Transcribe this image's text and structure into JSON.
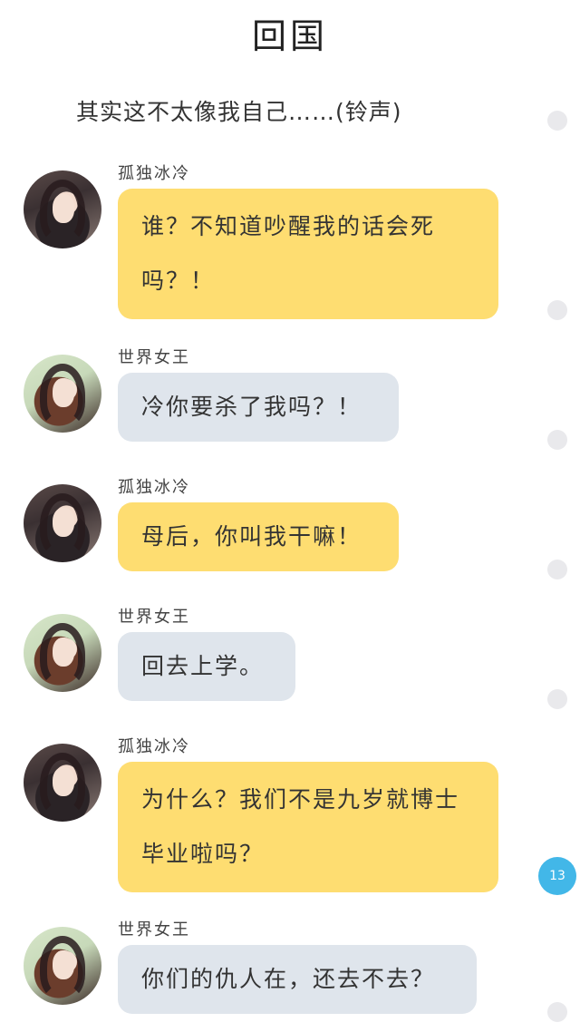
{
  "title": "回国",
  "narration": "其实这不太像我自己……(铃声)",
  "messages": [
    {
      "sender": "孤独冰冷",
      "text": "谁？不知道吵醒我的话会死吗？！",
      "style": "yellow"
    },
    {
      "sender": "世界女王",
      "text": "冷你要杀了我吗？！",
      "style": "grey"
    },
    {
      "sender": "孤独冰冷",
      "text": "母后，你叫我干嘛！",
      "style": "yellow"
    },
    {
      "sender": "世界女王",
      "text": "回去上学。",
      "style": "grey"
    },
    {
      "sender": "孤独冰冷",
      "text": "为什么？我们不是九岁就博士毕业啦吗？",
      "style": "yellow"
    },
    {
      "sender": "世界女王",
      "text": "你们的仇人在，还去不去？",
      "style": "grey"
    }
  ],
  "badge_count": "13",
  "colors": {
    "yellow_bubble": "#fedd71",
    "grey_bubble": "#dfe5ec",
    "badge": "#42b7e8"
  }
}
